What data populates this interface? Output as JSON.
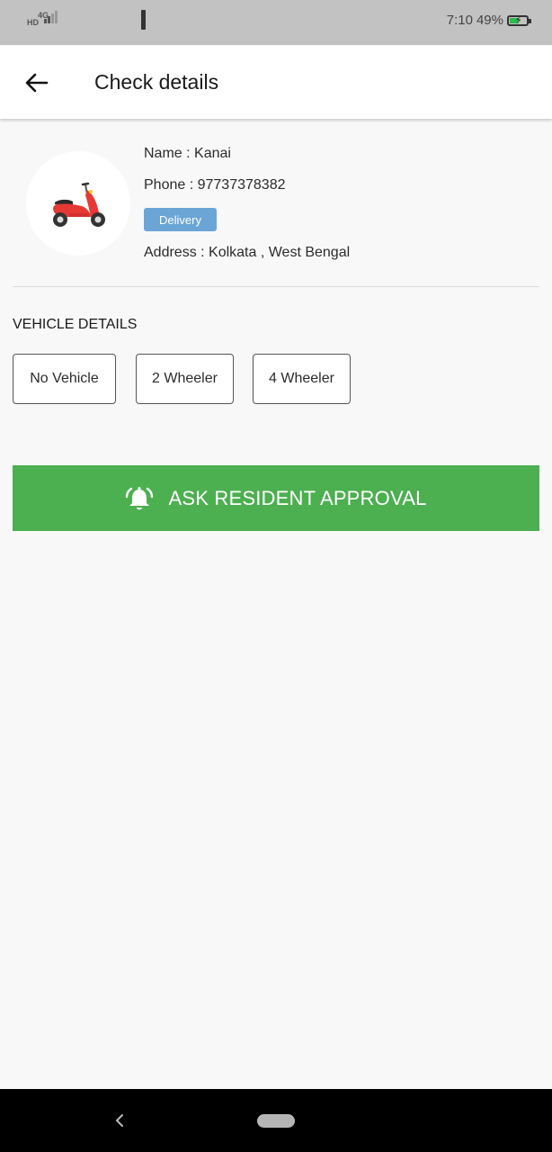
{
  "status_bar": {
    "network": "4G",
    "hd": "HD",
    "time": "7:10",
    "battery": "49%",
    "battery_level": 0.49
  },
  "header": {
    "title": "Check details",
    "back_icon": "arrow-left-icon"
  },
  "profile": {
    "avatar_icon": "scooter-icon",
    "name": "Name : Kanai",
    "phone": "Phone : 97737378382",
    "badge": "Delivery",
    "address": "Address : Kolkata , West Bengal"
  },
  "vehicle": {
    "section_title": "VEHICLE DETAILS",
    "options": [
      "No Vehicle",
      "2 Wheeler",
      "4 Wheeler"
    ]
  },
  "action": {
    "approve_label": "ASK RESIDENT APPROVAL",
    "icon": "alarm-bell-icon"
  },
  "colors": {
    "accent_green": "#4caf50",
    "badge_blue": "#6aa5d6",
    "status_bar": "#c2c2c2"
  }
}
